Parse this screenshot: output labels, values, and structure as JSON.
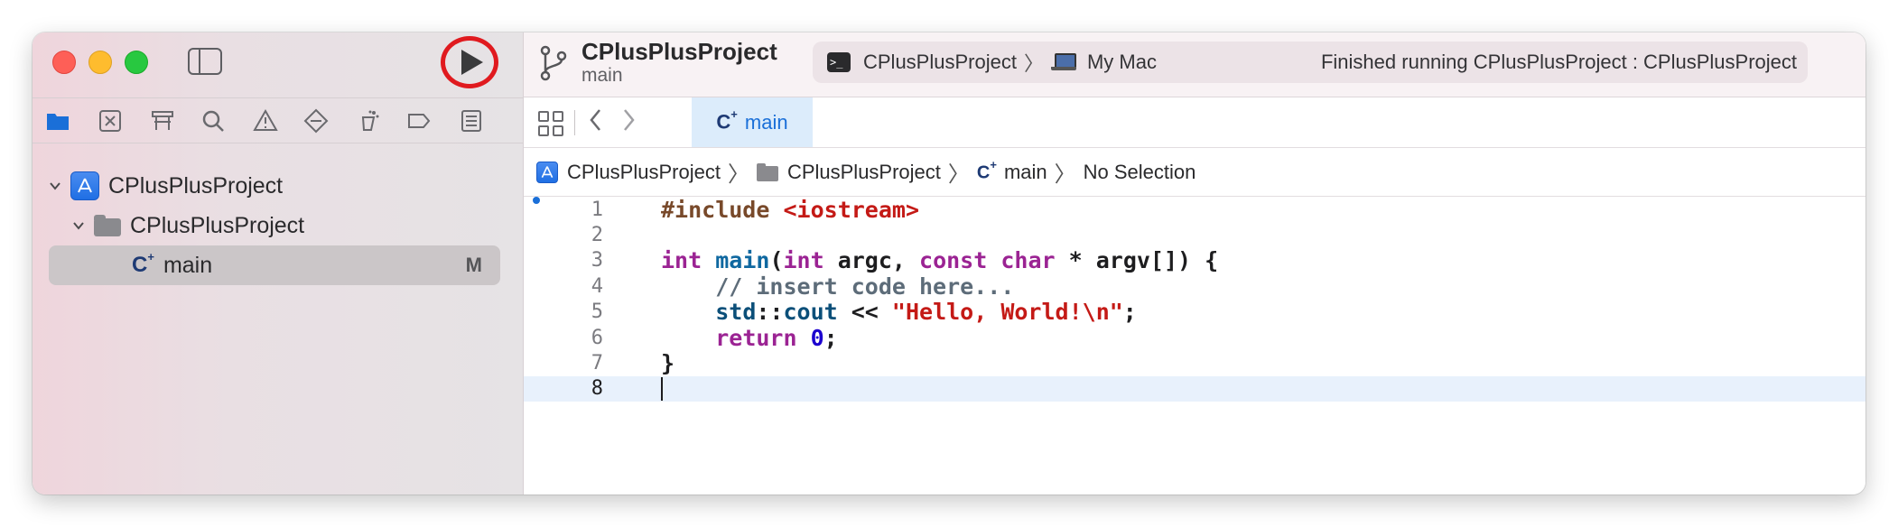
{
  "window": {
    "traffic_lights": [
      "close",
      "minimize",
      "zoom"
    ],
    "colors": {
      "close": "#fe5f57",
      "minimize": "#febc2e",
      "zoom": "#28c840",
      "run_highlight": "#e01a1f"
    }
  },
  "sidebar": {
    "tree": [
      {
        "label": "CPlusPlusProject",
        "type": "project",
        "expanded": true
      },
      {
        "label": "CPlusPlusProject",
        "type": "folder",
        "expanded": true
      },
      {
        "label": "main",
        "type": "cpp-file",
        "badge": "M",
        "selected": true
      }
    ],
    "nav_icons": [
      "folder-icon",
      "source-control-icon",
      "symbol-icon",
      "search-icon",
      "warning-icon",
      "test-icon",
      "debug-icon",
      "breakpoint-icon",
      "report-icon"
    ]
  },
  "toolbar": {
    "project_name": "CPlusPlusProject",
    "branch": "main",
    "scheme": "CPlusPlusProject",
    "destination": "My Mac",
    "status": "Finished running CPlusPlusProject : CPlusPlusProject"
  },
  "tabs": [
    {
      "label": "main",
      "glyph": "C",
      "glyph_sup": "+",
      "active": true
    }
  ],
  "jumpbar": {
    "items": [
      "CPlusPlusProject",
      "CPlusPlusProject",
      "main",
      "No Selection"
    ]
  },
  "editor": {
    "line_numbers": [
      "1",
      "2",
      "3",
      "4",
      "5",
      "6",
      "7",
      "8"
    ],
    "current_line": 8,
    "lines": {
      "l1_pp": "#include",
      "l1_inc": "<iostream>",
      "l3_kw1": "int",
      "l3_fn": "main",
      "l3_p1": "(",
      "l3_kw2": "int",
      "l3_t1": " argc, ",
      "l3_kw3": "const",
      "l3_kw4": "char",
      "l3_t2": " * argv[]) {",
      "l4_cm": "// insert code here...",
      "l5_tp1": "std",
      "l5_t1": "::",
      "l5_tp2": "cout",
      "l5_t2": " << ",
      "l5_str": "\"Hello, World!\\n\"",
      "l5_t3": ";",
      "l6_kw": "return",
      "l6_num": "0",
      "l6_t": ";",
      "l7_t": "}"
    }
  }
}
